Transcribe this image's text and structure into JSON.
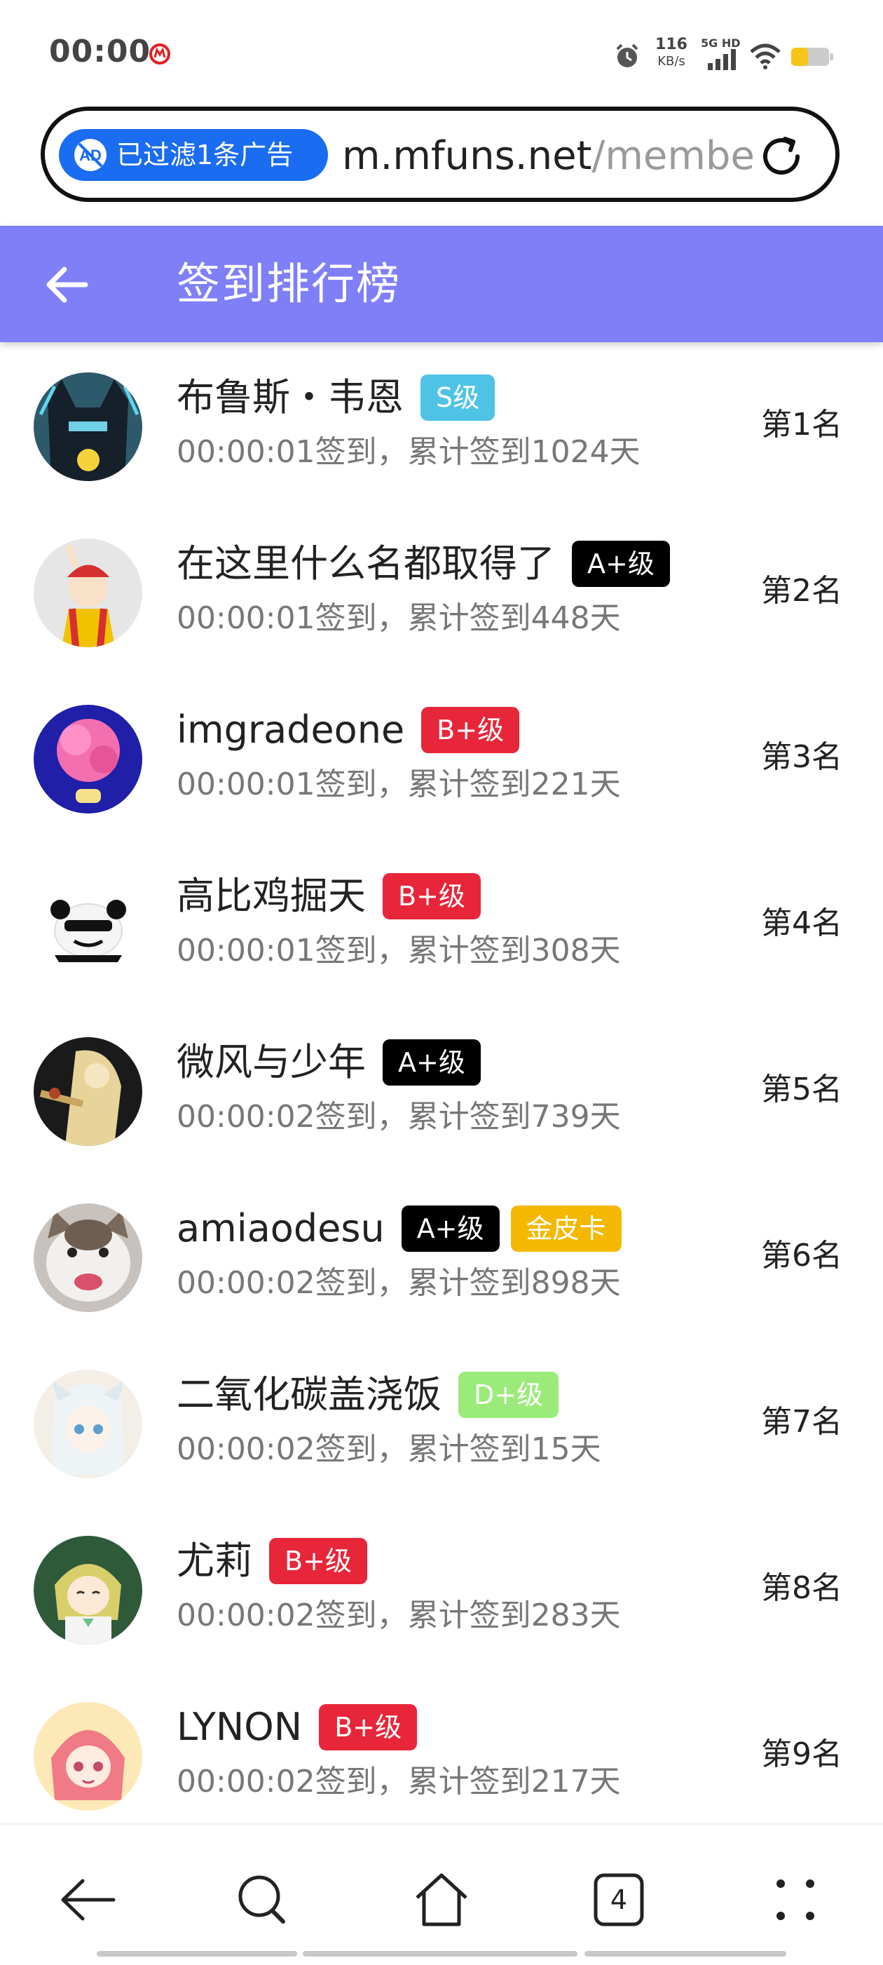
{
  "status_bar": {
    "time": "00:00",
    "net_speed_value": "116",
    "net_speed_unit": "KB/s",
    "network_label": "5G HD",
    "battery_color": "#f5c518"
  },
  "url_bar": {
    "ad_filter_label": "已过滤1条广告",
    "url_host": "m.mfuns.net",
    "url_path": "/membe",
    "accent_color": "#1a6cf0"
  },
  "header": {
    "title": "签到排行榜",
    "background_color": "#7f7ff8"
  },
  "rank_list": [
    {
      "name": "布鲁斯・韦恩",
      "badges": [
        {
          "text": "S级",
          "color": "#4fc3e6"
        }
      ],
      "checkin": "00:00:01签到，累计签到1024天",
      "rank": "第1名"
    },
    {
      "name": "在这里什么名都取得了",
      "badges": [
        {
          "text": "A+级",
          "color": "#000000"
        }
      ],
      "checkin": "00:00:01签到，累计签到448天",
      "rank": "第2名"
    },
    {
      "name": "imgradeone",
      "badges": [
        {
          "text": "B+级",
          "color": "#e8263a"
        }
      ],
      "checkin": "00:00:01签到，累计签到221天",
      "rank": "第3名"
    },
    {
      "name": "高比鸡掘天",
      "badges": [
        {
          "text": "B+级",
          "color": "#e8263a"
        }
      ],
      "checkin": "00:00:01签到，累计签到308天",
      "rank": "第4名"
    },
    {
      "name": "微风与少年",
      "badges": [
        {
          "text": "A+级",
          "color": "#000000"
        }
      ],
      "checkin": "00:00:02签到，累计签到739天",
      "rank": "第5名"
    },
    {
      "name": "amiaodesu",
      "badges": [
        {
          "text": "A+级",
          "color": "#000000"
        },
        {
          "text": "金皮卡",
          "color": "#f5b800"
        }
      ],
      "checkin": "00:00:02签到，累计签到898天",
      "rank": "第6名"
    },
    {
      "name": "二氧化碳盖浇饭",
      "badges": [
        {
          "text": "D+级",
          "color": "#9beb7a"
        }
      ],
      "checkin": "00:00:02签到，累计签到15天",
      "rank": "第7名"
    },
    {
      "name": "尤莉",
      "badges": [
        {
          "text": "B+级",
          "color": "#e8263a"
        }
      ],
      "checkin": "00:00:02签到，累计签到283天",
      "rank": "第8名"
    },
    {
      "name": "LYNON",
      "badges": [
        {
          "text": "B+级",
          "color": "#e8263a"
        }
      ],
      "checkin": "00:00:02签到，累计签到217天",
      "rank": "第9名"
    }
  ],
  "bottom_nav": {
    "tab_count": "4",
    "icons": [
      "back-icon",
      "search-icon",
      "home-icon",
      "tabs-icon",
      "menu-icon"
    ]
  }
}
